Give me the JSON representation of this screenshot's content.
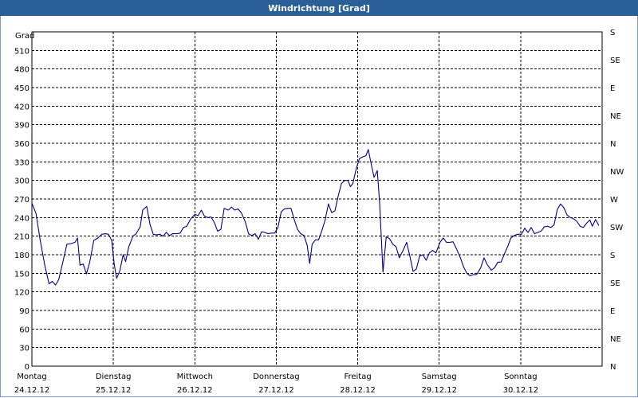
{
  "window": {
    "title": "Windrichtung [Grad]"
  },
  "colors": {
    "titlebar": "#2a5f97",
    "line": "#00008b",
    "grid": "#000000"
  },
  "chart_data": {
    "type": "line",
    "title": "Windrichtung [Grad]",
    "ylabel": "Grad",
    "ylim": [
      0,
      540
    ],
    "yticks": [
      0,
      30,
      60,
      90,
      120,
      150,
      180,
      210,
      240,
      270,
      300,
      330,
      360,
      390,
      420,
      450,
      480,
      510
    ],
    "y2_ticks": [
      {
        "value": 0,
        "label": "N"
      },
      {
        "value": 45,
        "label": "NE"
      },
      {
        "value": 90,
        "label": "E"
      },
      {
        "value": 135,
        "label": "SE"
      },
      {
        "value": 180,
        "label": "S"
      },
      {
        "value": 225,
        "label": "SW"
      },
      {
        "value": 270,
        "label": "W"
      },
      {
        "value": 315,
        "label": "NW"
      },
      {
        "value": 360,
        "label": "N"
      },
      {
        "value": 405,
        "label": "NE"
      },
      {
        "value": 450,
        "label": "E"
      },
      {
        "value": 495,
        "label": "SE"
      },
      {
        "value": 540,
        "label": "S"
      }
    ],
    "xlim": [
      0,
      7
    ],
    "x_ticks": [
      {
        "day": "Montag",
        "date": "24.12.12"
      },
      {
        "day": "Dienstag",
        "date": "25.12.12"
      },
      {
        "day": "Mittwoch",
        "date": "26.12.12"
      },
      {
        "day": "Donnerstag",
        "date": "27.12.12"
      },
      {
        "day": "Freitag",
        "date": "28.12.12"
      },
      {
        "day": "Samstag",
        "date": "29.12.12"
      },
      {
        "day": "Sonntag",
        "date": "30.12.12"
      }
    ],
    "grid": true,
    "series": [
      {
        "points": [
          [
            0.0,
            263
          ],
          [
            0.05,
            247
          ],
          [
            0.1,
            205
          ],
          [
            0.16,
            162
          ],
          [
            0.21,
            133
          ],
          [
            0.25,
            137
          ],
          [
            0.29,
            131
          ],
          [
            0.33,
            140
          ],
          [
            0.38,
            168
          ],
          [
            0.43,
            197
          ],
          [
            0.48,
            198
          ],
          [
            0.53,
            200
          ],
          [
            0.56,
            207
          ],
          [
            0.59,
            163
          ],
          [
            0.63,
            165
          ],
          [
            0.67,
            149
          ],
          [
            0.71,
            168
          ],
          [
            0.76,
            203
          ],
          [
            0.81,
            207
          ],
          [
            0.86,
            213
          ],
          [
            0.9,
            214
          ],
          [
            0.94,
            213
          ],
          [
            0.98,
            203
          ],
          [
            1.01,
            165
          ],
          [
            1.04,
            142
          ],
          [
            1.08,
            154
          ],
          [
            1.12,
            180
          ],
          [
            1.15,
            169
          ],
          [
            1.19,
            193
          ],
          [
            1.24,
            210
          ],
          [
            1.28,
            214
          ],
          [
            1.33,
            225
          ],
          [
            1.36,
            252
          ],
          [
            1.41,
            258
          ],
          [
            1.45,
            229
          ],
          [
            1.49,
            213
          ],
          [
            1.53,
            212
          ],
          [
            1.57,
            213
          ],
          [
            1.61,
            210
          ],
          [
            1.65,
            216
          ],
          [
            1.69,
            211
          ],
          [
            1.73,
            214
          ],
          [
            1.78,
            214
          ],
          [
            1.82,
            215
          ],
          [
            1.86,
            224
          ],
          [
            1.9,
            226
          ],
          [
            1.95,
            238
          ],
          [
            2.0,
            245
          ],
          [
            2.04,
            243
          ],
          [
            2.08,
            252
          ],
          [
            2.12,
            242
          ],
          [
            2.16,
            240
          ],
          [
            2.2,
            241
          ],
          [
            2.24,
            232
          ],
          [
            2.28,
            218
          ],
          [
            2.32,
            221
          ],
          [
            2.36,
            255
          ],
          [
            2.41,
            252
          ],
          [
            2.45,
            257
          ],
          [
            2.49,
            252
          ],
          [
            2.53,
            254
          ],
          [
            2.57,
            248
          ],
          [
            2.62,
            233
          ],
          [
            2.66,
            214
          ],
          [
            2.7,
            211
          ],
          [
            2.74,
            214
          ],
          [
            2.78,
            205
          ],
          [
            2.82,
            217
          ],
          [
            2.86,
            216
          ],
          [
            2.9,
            214
          ],
          [
            2.94,
            215
          ],
          [
            2.98,
            215
          ],
          [
            3.02,
            224
          ],
          [
            3.06,
            249
          ],
          [
            3.1,
            254
          ],
          [
            3.15,
            255
          ],
          [
            3.18,
            255
          ],
          [
            3.22,
            237
          ],
          [
            3.26,
            221
          ],
          [
            3.3,
            214
          ],
          [
            3.34,
            211
          ],
          [
            3.38,
            195
          ],
          [
            3.41,
            166
          ],
          [
            3.44,
            197
          ],
          [
            3.48,
            204
          ],
          [
            3.52,
            204
          ],
          [
            3.56,
            219
          ],
          [
            3.6,
            236
          ],
          [
            3.64,
            262
          ],
          [
            3.68,
            248
          ],
          [
            3.72,
            251
          ],
          [
            3.76,
            275
          ],
          [
            3.8,
            295
          ],
          [
            3.84,
            300
          ],
          [
            3.88,
            300
          ],
          [
            3.91,
            290
          ],
          [
            3.94,
            295
          ],
          [
            3.98,
            318
          ],
          [
            4.02,
            335
          ],
          [
            4.06,
            338
          ],
          [
            4.1,
            340
          ],
          [
            4.13,
            350
          ],
          [
            4.16,
            330
          ],
          [
            4.2,
            305
          ],
          [
            4.24,
            316
          ],
          [
            4.27,
            262
          ],
          [
            4.31,
            152
          ],
          [
            4.35,
            209
          ],
          [
            4.39,
            206
          ],
          [
            4.43,
            197
          ],
          [
            4.47,
            193
          ],
          [
            4.51,
            175
          ],
          [
            4.56,
            188
          ],
          [
            4.6,
            200
          ],
          [
            4.64,
            178
          ],
          [
            4.68,
            153
          ],
          [
            4.72,
            157
          ],
          [
            4.76,
            178
          ],
          [
            4.8,
            180
          ],
          [
            4.84,
            171
          ],
          [
            4.88,
            183
          ],
          [
            4.92,
            187
          ],
          [
            4.96,
            183
          ],
          [
            5.01,
            200
          ],
          [
            5.05,
            207
          ],
          [
            5.09,
            200
          ],
          [
            5.13,
            200
          ],
          [
            5.17,
            201
          ],
          [
            5.21,
            190
          ],
          [
            5.26,
            175
          ],
          [
            5.3,
            160
          ],
          [
            5.34,
            150
          ],
          [
            5.38,
            146
          ],
          [
            5.42,
            148
          ],
          [
            5.46,
            148
          ],
          [
            5.51,
            159
          ],
          [
            5.55,
            175
          ],
          [
            5.59,
            164
          ],
          [
            5.64,
            155
          ],
          [
            5.68,
            159
          ],
          [
            5.72,
            168
          ],
          [
            5.76,
            168
          ],
          [
            5.8,
            181
          ],
          [
            5.84,
            193
          ],
          [
            5.88,
            207
          ],
          [
            5.92,
            211
          ],
          [
            5.96,
            213
          ],
          [
            6.01,
            213
          ],
          [
            6.05,
            223
          ],
          [
            6.09,
            216
          ],
          [
            6.13,
            224
          ],
          [
            6.17,
            214
          ],
          [
            6.21,
            216
          ],
          [
            6.25,
            218
          ],
          [
            6.29,
            225
          ],
          [
            6.33,
            226
          ],
          [
            6.37,
            224
          ],
          [
            6.41,
            228
          ],
          [
            6.45,
            253
          ],
          [
            6.49,
            262
          ],
          [
            6.53,
            256
          ],
          [
            6.57,
            244
          ],
          [
            6.61,
            240
          ],
          [
            6.65,
            238
          ],
          [
            6.69,
            234
          ],
          [
            6.73,
            226
          ],
          [
            6.77,
            224
          ],
          [
            6.81,
            231
          ],
          [
            6.85,
            236
          ],
          [
            6.88,
            226
          ],
          [
            6.92,
            237
          ],
          [
            6.96,
            227
          ]
        ]
      }
    ]
  }
}
